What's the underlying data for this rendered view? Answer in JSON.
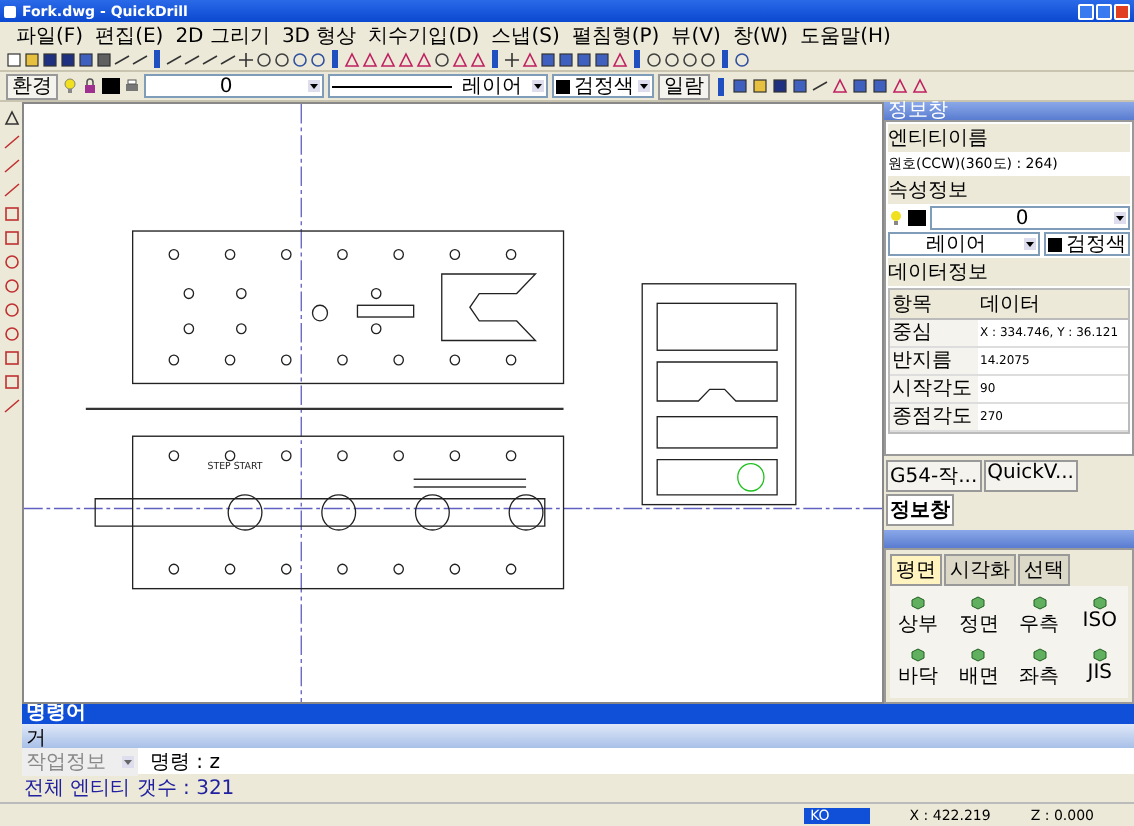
{
  "window": {
    "title": "Fork.dwg - QuickDrill"
  },
  "menu": [
    "파일(F)",
    "편집(E)",
    "2D 그리기",
    "3D 형상",
    "치수기입(D)",
    "스냅(S)",
    "펼침형(P)",
    "뷰(V)",
    "창(W)",
    "도움말(H)"
  ],
  "properties_toolbar": {
    "env_button": "환경",
    "layer": "0",
    "linetype": "레이어",
    "color_name": "검정색",
    "list_button": "일람"
  },
  "canvas": {
    "label": "STEP START"
  },
  "info_panel": {
    "title": "정보창",
    "entity_label": "엔티티이름",
    "entity": "원호(CCW)(360도) : 264)",
    "attr_label": "속성정보",
    "layer": "0",
    "linetype": "레이어",
    "color_name": "검정색",
    "data_label": "데이터정보",
    "columns": [
      "항목",
      "데이터"
    ],
    "rows": [
      [
        "중심",
        "X : 334.746, Y : 36.121"
      ],
      [
        "반지름",
        "14.2075"
      ],
      [
        "시작각도",
        "90"
      ],
      [
        "종점각도",
        "270"
      ]
    ]
  },
  "panel_tabs": [
    {
      "label": "G54-작...",
      "selected": false
    },
    {
      "label": "QuickV...",
      "selected": false
    },
    {
      "label": "정보창",
      "selected": true
    }
  ],
  "view_panel": {
    "tabs": [
      {
        "label": "평면",
        "selected": true
      },
      {
        "label": "시각화",
        "selected": false
      },
      {
        "label": "선택",
        "selected": false
      }
    ],
    "buttons": [
      "상부",
      "정면",
      "우측",
      "ISO",
      "바닥",
      "배면",
      "좌측",
      "JIS"
    ]
  },
  "command": {
    "title": "명령어",
    "history": "거",
    "mode": "작업정보",
    "prompt": "명령 : z",
    "output": "전체 엔티티 갯수 : 321"
  },
  "status": {
    "x": "X : 422.219",
    "z": "Z : 0.000",
    "ime": "KO"
  }
}
